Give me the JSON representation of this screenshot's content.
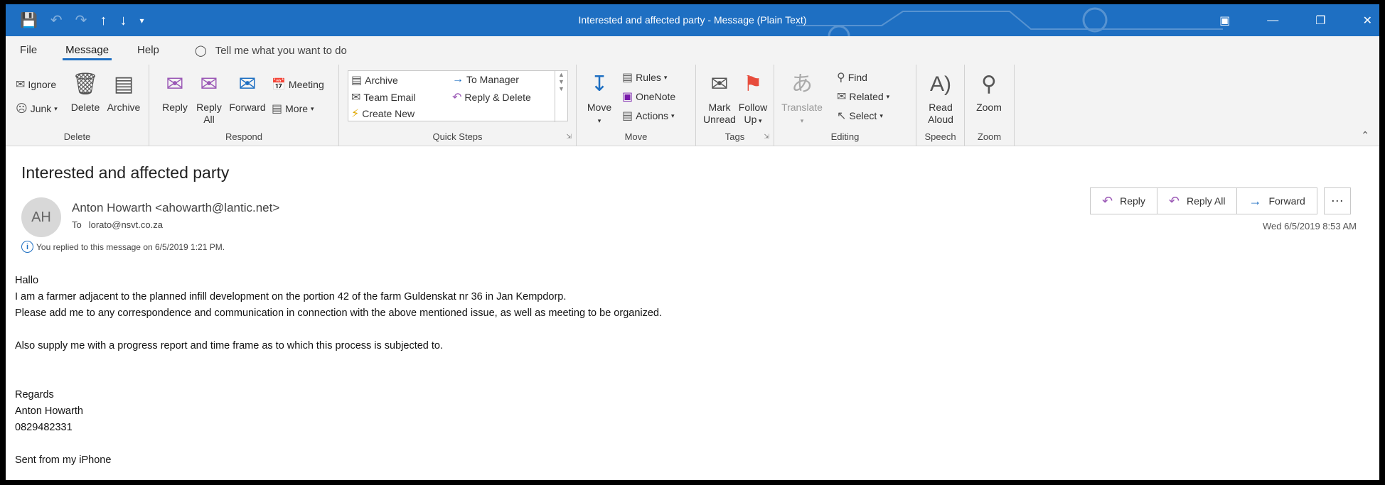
{
  "window": {
    "title": "Interested and affected party  -  Message (Plain Text)",
    "accent": "#1e6fc2"
  },
  "quick_access": [
    "save-icon",
    "undo-icon",
    "redo-icon",
    "up-arrow-icon",
    "down-arrow-icon",
    "customize-icon"
  ],
  "menu": {
    "file": "File",
    "message": "Message",
    "help": "Help",
    "tell_me": "Tell me what you want to do"
  },
  "ribbon": {
    "delete_group": {
      "label": "Delete",
      "ignore": "Ignore",
      "junk": "Junk",
      "delete": "Delete",
      "archive": "Archive"
    },
    "respond_group": {
      "label": "Respond",
      "reply": "Reply",
      "reply_all_1": "Reply",
      "reply_all_2": "All",
      "forward": "Forward",
      "meeting": "Meeting",
      "more": "More"
    },
    "quick_steps_group": {
      "label": "Quick Steps",
      "archive": "Archive",
      "to_manager": "To Manager",
      "team_email": "Team Email",
      "reply_delete": "Reply & Delete",
      "create_new": "Create New"
    },
    "move_group": {
      "label": "Move",
      "move": "Move",
      "rules": "Rules",
      "onenote": "OneNote",
      "actions": "Actions"
    },
    "tags_group": {
      "label": "Tags",
      "mark_unread_1": "Mark",
      "mark_unread_2": "Unread",
      "follow_up_1": "Follow",
      "follow_up_2": "Up"
    },
    "editing_group": {
      "label": "Editing",
      "translate": "Translate",
      "find": "Find",
      "related": "Related",
      "select": "Select"
    },
    "speech_group": {
      "label": "Speech",
      "read_aloud_1": "Read",
      "read_aloud_2": "Aloud"
    },
    "zoom_group": {
      "label": "Zoom",
      "zoom": "Zoom"
    }
  },
  "message": {
    "subject": "Interested and affected party",
    "avatar_initials": "AH",
    "sender": "Anton Howarth <ahowarth@lantic.net>",
    "to_label": "To",
    "to": "lorato@nsvt.co.za",
    "replied_notice": "You replied to this message on 6/5/2019 1:21 PM.",
    "date": "Wed 6/5/2019 8:53 AM",
    "reply": "Reply",
    "reply_all": "Reply All",
    "forward": "Forward",
    "more": "···",
    "body": {
      "l1": "Hallo",
      "l2": "I am a farmer adjacent to the planned infill development on the portion 42 of the farm Guldenskat nr 36 in Jan Kempdorp.",
      "l3": "Please add me to any correspondence and communication in connection with the above mentioned issue, as well as meeting to be organized.",
      "l4": "",
      "l5": "Also supply me with a progress report and time frame as to which this process is subjected to.",
      "l6": "",
      "l7": "",
      "l8": "Regards",
      "l9": "Anton Howarth",
      "l10": "0829482331",
      "l11": "",
      "l12": "Sent from my iPhone"
    }
  }
}
